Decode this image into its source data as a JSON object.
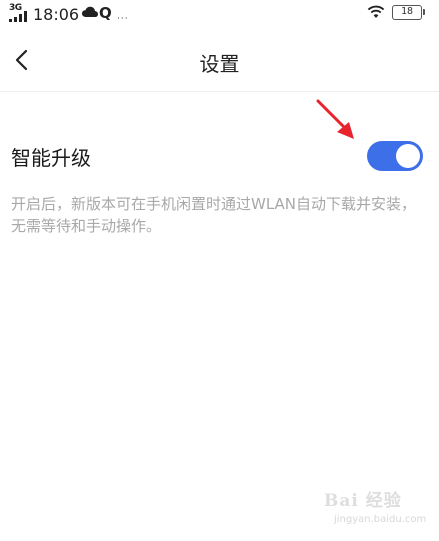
{
  "status_bar": {
    "network": "3G",
    "time": "18:06",
    "q_icon_glyph": "Q",
    "dots": "···",
    "battery": "18"
  },
  "header": {
    "title": "设置"
  },
  "setting": {
    "label": "智能升级",
    "enabled": true,
    "description": "开启后，新版本可在手机闲置时通过WLAN自动下载并安装，无需等待和手动操作。"
  },
  "watermark": {
    "text": "Bai 经验",
    "sub": "jingyan.baidu.com"
  },
  "colors": {
    "toggle_on": "#3d6fe8",
    "arrow": "#e8232e",
    "description_text": "#a8a8a8"
  }
}
